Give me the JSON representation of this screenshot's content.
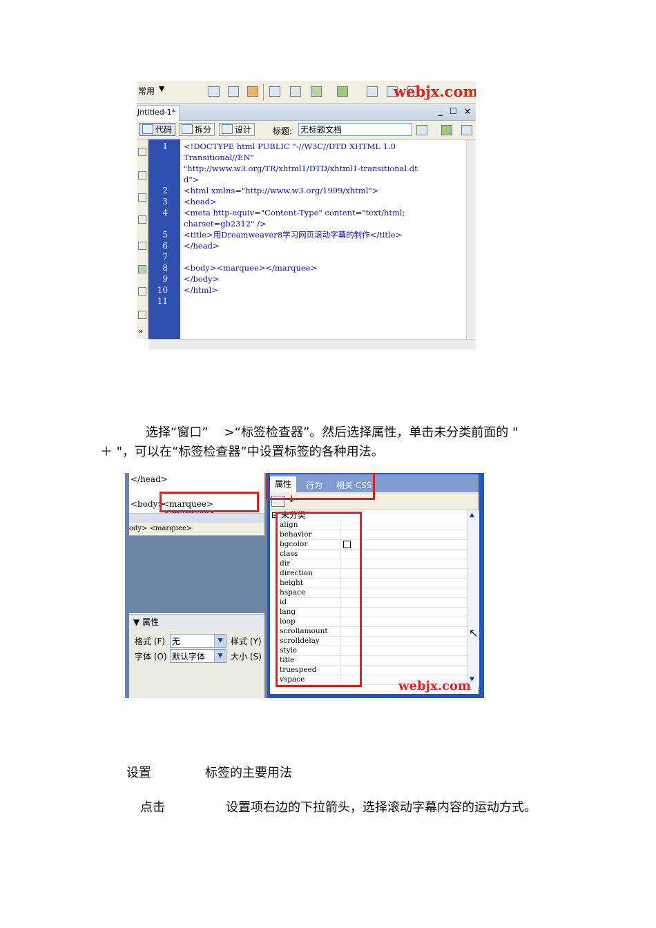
{
  "screenshot1": {
    "toolbar": {
      "category_label": "常用",
      "dropdown_arrow": "▼",
      "watermark": "webjx.com"
    },
    "tab": {
      "title": "Jntitled-1*",
      "controls": "_ ☐ ×"
    },
    "viewbar": {
      "code_label": "代码",
      "split_label": "拆分",
      "design_label": "设计",
      "title_label": "标题:",
      "title_value": "无标题文档"
    },
    "line_numbers": [
      "1",
      "2",
      "3",
      "4",
      "5",
      "6",
      "7",
      "8",
      "9",
      "10",
      "11"
    ],
    "code_lines": [
      "<!DOCTYPE html PUBLIC \"-//W3C//DTD XHTML 1.0",
      "Transitional//EN\"",
      "\"http://www.w3.org/TR/xhtml1/DTD/xhtml1-transitional.dt",
      "d\">",
      "<html xmlns=\"http://www.w3.org/1999/xhtml\">",
      "<head>",
      "<meta http-equiv=\"Content-Type\" content=\"text/html;",
      "charset=gb2312\" />",
      "<title>用Dreamweaver8学习网页滚动字幕的制作</title>",
      "</head>",
      "",
      "<body><marquee></marquee>",
      "</body>",
      "</html>"
    ]
  },
  "paragraph1": {
    "line1": "选择“窗口”    >“标签检查器”。然后选择属性，单击未分类前面的 \"",
    "line2": "＋ \"，可以在“标签检查器”中设置标签的各种用法。"
  },
  "screenshot2": {
    "code_head": "</head>",
    "code_body_prefix": "<body>",
    "code_marquee": "<marquee></marquee>",
    "tagbar_text": "ody> <marquee>",
    "prop_header": "▼ 属性",
    "format_label": "格式 (F)",
    "format_value": "无",
    "style_label": "样式 (Y)",
    "font_label": "字体 (O)",
    "font_value": "默认字体",
    "size_label": "大小 (S)",
    "tabs": [
      "属性",
      "行为",
      "相关 CSS"
    ],
    "category": "未分类",
    "attributes": [
      "align",
      "behavior",
      "bgcolor",
      "class",
      "dir",
      "direction",
      "height",
      "hspace",
      "id",
      "lang",
      "loop",
      "scrollamount",
      "scrolldelay",
      "style",
      "title",
      "truespeed",
      "vspace"
    ],
    "watermark": "webjx.com"
  },
  "heading": {
    "left": "设置",
    "right": "标签的主要用法"
  },
  "paragraph2": {
    "left": "点击",
    "right": "设置项右边的下拉箭头，选择滚动字幕内容的运动方式。"
  },
  "colors": {
    "line_number_bg": "#3050b0",
    "code_text": "#15159a",
    "highlight_red": "#e02020",
    "panel_blue": "#2a55c8"
  }
}
